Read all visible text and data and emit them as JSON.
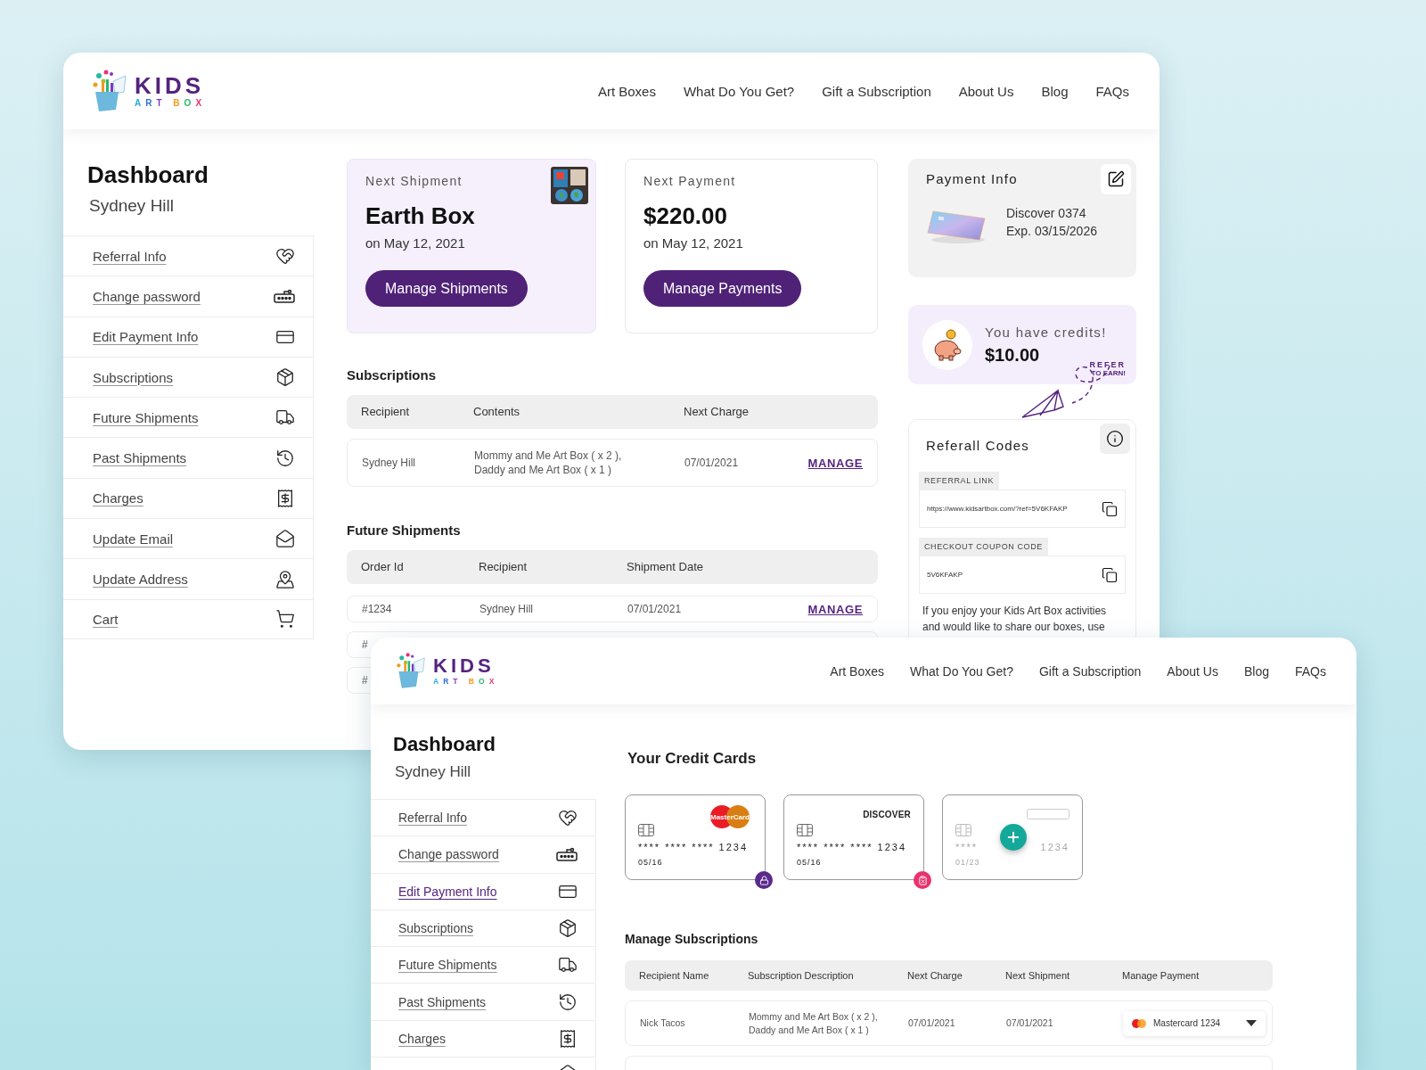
{
  "back_window": {
    "header": {
      "logo": {
        "title": "KIDS",
        "subtitle": "ART BOX"
      },
      "nav": [
        "Art Boxes",
        "What Do You Get?",
        "Gift a Subscription",
        "About Us",
        "Blog",
        "FAQs"
      ]
    },
    "sidebar": {
      "title": "Dashboard",
      "user": "Sydney Hill",
      "items": [
        {
          "label": "Referral Info",
          "selected": false
        },
        {
          "label": "Change password",
          "selected": false
        },
        {
          "label": "Edit Payment Info",
          "selected": false
        },
        {
          "label": "Subscriptions",
          "selected": false
        },
        {
          "label": "Future Shipments",
          "selected": false
        },
        {
          "label": "Past Shipments",
          "selected": false
        },
        {
          "label": "Charges",
          "selected": false
        },
        {
          "label": "Update Email",
          "selected": false
        },
        {
          "label": "Update Address",
          "selected": false
        },
        {
          "label": "Cart",
          "selected": false
        }
      ]
    },
    "shipment_card": {
      "label": "Next Shipment",
      "title": "Earth Box",
      "date": "on May 12, 2021",
      "button": "Manage Shipments"
    },
    "payment_card": {
      "label": "Next Payment",
      "title": "$220.00",
      "date": "on May 12, 2021",
      "button": "Manage Payments"
    },
    "subscriptions": {
      "title": "Subscriptions",
      "columns": [
        "Recipient",
        "Contents",
        "Next Charge"
      ],
      "rows": [
        {
          "recipient": "Sydney Hill",
          "contents": [
            "Mommy and Me Art Box ( x 2 ),",
            "Daddy and Me Art Box ( x 1 )"
          ],
          "next_charge": "07/01/2021",
          "action": "MANAGE"
        }
      ]
    },
    "future_shipments": {
      "title": "Future Shipments",
      "columns": [
        "Order Id",
        "Recipient",
        "Shipment Date"
      ],
      "rows": [
        {
          "order_id": "#1234",
          "recipient": "Sydney Hill",
          "date": "07/01/2021",
          "action": "MANAGE"
        },
        {
          "order_id": "#"
        },
        {
          "order_id": "#"
        }
      ]
    },
    "payment_info": {
      "title": "Payment Info",
      "card": "Discover 0374",
      "expiry": "Exp. 03/15/2026"
    },
    "credits": {
      "label": "You have credits!",
      "amount": "$10.00",
      "refer": "REFER",
      "refer_sub": "TO EARN!"
    },
    "referral": {
      "title": "Referall Codes",
      "link_label": "REFERRAL LINK",
      "link": "https://www.kidsartbox.com/?ref=5V6KFAKP",
      "coupon_label": "CHECKOUT COUPON CODE",
      "coupon": "5V6KFAKP",
      "text": "If you enjoy your Kids Art Box activities and would like to share our boxes, use"
    }
  },
  "front_window": {
    "header": {
      "logo": {
        "title": "KIDS",
        "subtitle": "ART BOX"
      },
      "nav": [
        "Art Boxes",
        "What Do You Get?",
        "Gift a Subscription",
        "About Us",
        "Blog",
        "FAQs"
      ]
    },
    "sidebar": {
      "title": "Dashboard",
      "user": "Sydney Hill",
      "items": [
        {
          "label": "Referral Info",
          "selected": false
        },
        {
          "label": "Change password",
          "selected": false
        },
        {
          "label": "Edit Payment Info",
          "selected": true
        },
        {
          "label": "Subscriptions",
          "selected": false
        },
        {
          "label": "Future Shipments",
          "selected": false
        },
        {
          "label": "Past Shipments",
          "selected": false
        },
        {
          "label": "Charges",
          "selected": false
        }
      ]
    },
    "credit_cards": {
      "title": "Your Credit Cards",
      "cards": [
        {
          "kind": "locked",
          "brand": "MasterCard",
          "number": "**** **** **** 1234",
          "expiry": "05/16"
        },
        {
          "kind": "removable",
          "brand": "DISCOVER",
          "number": "**** **** **** 1234",
          "expiry": "05/16"
        },
        {
          "kind": "add",
          "number_start": "****",
          "number_end": "1234",
          "expiry": "01/23"
        }
      ]
    },
    "manage_subscriptions": {
      "title": "Manage Subscriptions",
      "columns": [
        "Recipient Name",
        "Subscription Description",
        "Next Charge",
        "Next Shipment",
        "Manage Payment"
      ],
      "rows": [
        {
          "recipient": "Nick Tacos",
          "description": [
            "Mommy and Me Art Box ( x 2 ),",
            "Daddy and Me Art Box ( x 1 )"
          ],
          "next_charge": "07/01/2021",
          "next_shipment": "07/01/2021",
          "payment": "Mastercard 1234"
        }
      ]
    }
  }
}
